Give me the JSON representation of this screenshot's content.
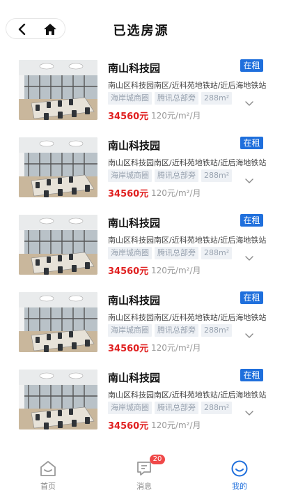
{
  "header": {
    "title": "已选房源",
    "back_icon": "chevron-left-icon",
    "home_icon": "home-icon"
  },
  "listings": [
    {
      "name": "南山科技园",
      "status": "在租",
      "address": "南山区科技园南区/近科苑地铁站/近后海地铁站",
      "tags": [
        "海岸城商圈",
        "腾讯总部旁",
        "288m²"
      ],
      "price": "34560元",
      "unit_price": "120元/m²/月"
    },
    {
      "name": "南山科技园",
      "status": "在租",
      "address": "南山区科技园南区/近科苑地铁站/近后海地铁站",
      "tags": [
        "海岸城商圈",
        "腾讯总部旁",
        "288m²"
      ],
      "price": "34560元",
      "unit_price": "120元/m²/月"
    },
    {
      "name": "南山科技园",
      "status": "在租",
      "address": "南山区科技园南区/近科苑地铁站/近后海地铁站",
      "tags": [
        "海岸城商圈",
        "腾讯总部旁",
        "288m²"
      ],
      "price": "34560元",
      "unit_price": "120元/m²/月"
    },
    {
      "name": "南山科技园",
      "status": "在租",
      "address": "南山区科技园南区/近科苑地铁站/近后海地铁站",
      "tags": [
        "海岸城商圈",
        "腾讯总部旁",
        "288m²"
      ],
      "price": "34560元",
      "unit_price": "120元/m²/月"
    },
    {
      "name": "南山科技园",
      "status": "在租",
      "address": "南山区科技园南区/近科苑地铁站/近后海地铁站",
      "tags": [
        "海岸城商圈",
        "腾讯总部旁",
        "288m²"
      ],
      "price": "34560元",
      "unit_price": "120元/m²/月"
    }
  ],
  "tabbar": {
    "items": [
      {
        "label": "首页",
        "icon": "home-outline-icon"
      },
      {
        "label": "消息",
        "icon": "message-icon",
        "badge": "20"
      },
      {
        "label": "我的",
        "icon": "profile-smile-icon",
        "active": true
      }
    ]
  },
  "colors": {
    "accent": "#1f6fdc",
    "price": "#e02020",
    "badge": "#f04848"
  }
}
